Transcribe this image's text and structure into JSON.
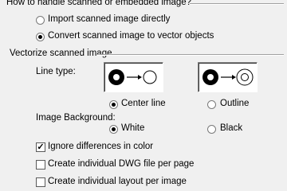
{
  "handling": {
    "title": "How to handle scanned or embedded image?",
    "options": [
      {
        "label": "Import scanned image directly",
        "selected": false
      },
      {
        "label": "Convert scanned image to vector objects",
        "selected": true
      }
    ]
  },
  "vectorize": {
    "title": "Vectorize scanned image",
    "line_type_label": "Line type:",
    "line_type_options": [
      {
        "label": "Center line",
        "selected": true
      },
      {
        "label": "Outline",
        "selected": false
      }
    ],
    "background_label": "Image Background:",
    "background_options": [
      {
        "label": "White",
        "selected": true
      },
      {
        "label": "Black",
        "selected": false
      }
    ]
  },
  "checkboxes": [
    {
      "label": "Ignore differences in color",
      "checked": true
    },
    {
      "label": "Create individual DWG file per page",
      "checked": false
    },
    {
      "label": "Create  individual layout per image",
      "checked": false
    }
  ],
  "icons": {
    "centerline_preview": "centerline-preview-icon",
    "outline_preview": "outline-preview-icon"
  }
}
